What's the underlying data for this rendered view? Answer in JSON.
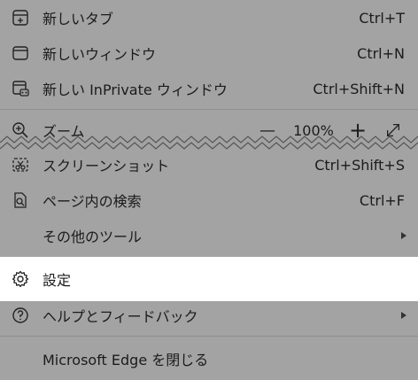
{
  "menu": {
    "new_tab": {
      "label": "新しいタブ",
      "shortcut": "Ctrl+T"
    },
    "new_window": {
      "label": "新しいウィンドウ",
      "shortcut": "Ctrl+N"
    },
    "new_inprivate": {
      "label": "新しい InPrivate ウィンドウ",
      "shortcut": "Ctrl+Shift+N"
    },
    "zoom": {
      "label": "ズーム",
      "level": "100%",
      "decrease": "—",
      "increase": "+"
    },
    "screenshot": {
      "label": "スクリーンショット",
      "shortcut": "Ctrl+Shift+S"
    },
    "find": {
      "label": "ページ内の検索",
      "shortcut": "Ctrl+F"
    },
    "more_tools": {
      "label": "その他のツール"
    },
    "settings": {
      "label": "設定"
    },
    "help": {
      "label": "ヘルプとフィードバック"
    },
    "close": {
      "label": "Microsoft Edge を閉じる"
    }
  },
  "colors": {
    "dimmed_bg": "#a3a3a3",
    "highlight_bg": "#ffffff",
    "text": "#1b1b1b"
  }
}
